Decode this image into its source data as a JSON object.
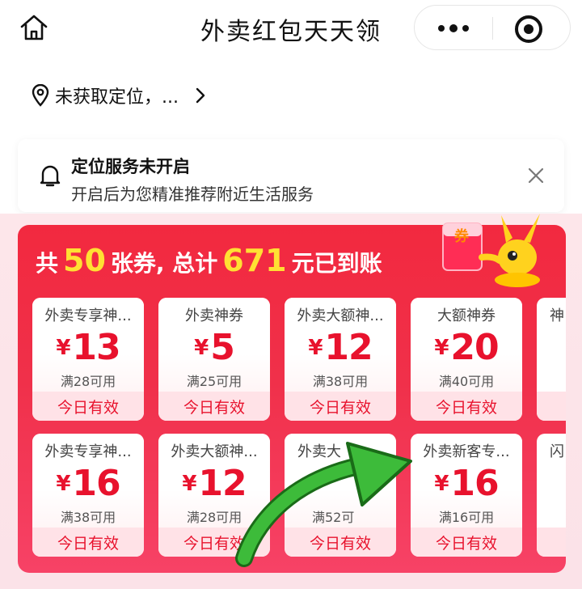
{
  "header": {
    "title": "外卖红包天天领"
  },
  "location": {
    "text": "未获取定位，..."
  },
  "notice": {
    "title": "定位服务未开启",
    "subtitle": "开启后为您精准推荐附近生活服务"
  },
  "banner": {
    "prefix": "共",
    "count": "50",
    "middle": "张券, 总计",
    "total": "671",
    "suffix": "元已到账"
  },
  "mascot": {
    "tag": "券"
  },
  "coupons": [
    {
      "name": "外卖专享神...",
      "currency": "¥",
      "value": "13",
      "condition": "满28可用",
      "validity": "今日有效"
    },
    {
      "name": "外卖神券",
      "currency": "¥",
      "value": "5",
      "condition": "满25可用",
      "validity": "今日有效"
    },
    {
      "name": "外卖大额神...",
      "currency": "¥",
      "value": "12",
      "condition": "满38可用",
      "validity": "今日有效"
    },
    {
      "name": "大额神券",
      "currency": "¥",
      "value": "20",
      "condition": "满40可用",
      "validity": "今日有效"
    },
    {
      "name": "神",
      "currency": "",
      "value": "",
      "condition": "",
      "validity": ""
    },
    {
      "name": "外卖专享神...",
      "currency": "¥",
      "value": "16",
      "condition": "满38可用",
      "validity": "今日有效"
    },
    {
      "name": "外卖大额神...",
      "currency": "¥",
      "value": "12",
      "condition": "满28可用",
      "validity": "今日有效"
    },
    {
      "name": "外卖大",
      "currency": "",
      "value": "",
      "condition": "满52可",
      "validity": "今日有效"
    },
    {
      "name": "外卖新客专...",
      "currency": "¥",
      "value": "16",
      "condition": "满16可用",
      "validity": "今日有效"
    },
    {
      "name": "闪",
      "currency": "",
      "value": "",
      "condition": "",
      "validity": ""
    }
  ],
  "colors": {
    "red": "#f2293f",
    "yellow": "#ffe033",
    "coupon_red": "#e8122d",
    "arrow_green": "#3dbb3a"
  },
  "icons": [
    "home-icon",
    "more-dots-icon",
    "record-icon",
    "location-pin-icon",
    "chevron-right-icon",
    "bell-icon",
    "close-icon",
    "green-arrow"
  ]
}
